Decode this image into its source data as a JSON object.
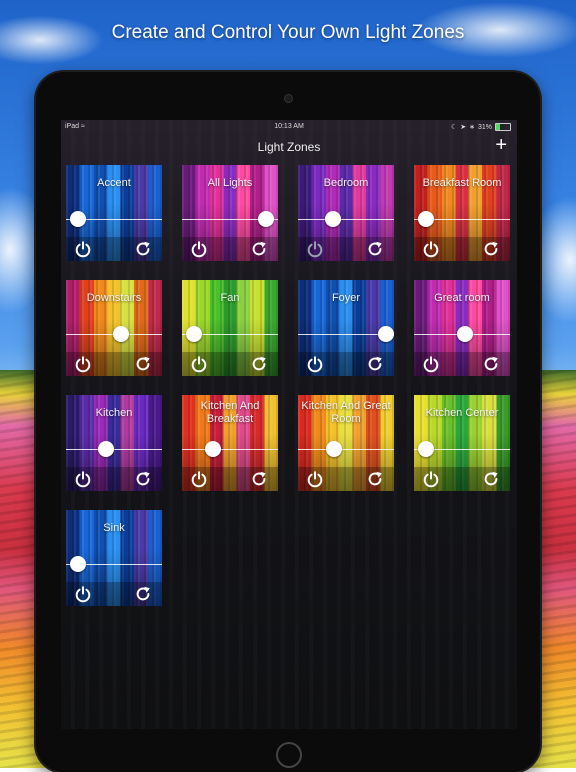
{
  "headline": "Create and Control Your Own Light Zones",
  "status_bar": {
    "carrier": "iPad",
    "time": "10:13 AM",
    "battery": "31%",
    "battery_level": 0.31
  },
  "nav": {
    "title": "Light Zones",
    "add_symbol": "+"
  },
  "icons": {
    "power": "power-icon",
    "refresh": "refresh-icon",
    "wifi": "wifi-icon",
    "add": "plus-icon"
  },
  "zones": [
    {
      "name": "Accent",
      "brightness": 0.12,
      "palette": "blue",
      "power_on": true
    },
    {
      "name": "All Lights",
      "brightness": 0.88,
      "palette": "magenta",
      "power_on": true
    },
    {
      "name": "Bedroom",
      "brightness": 0.36,
      "palette": "purple",
      "power_on": false
    },
    {
      "name": "Breakfast Room",
      "brightness": 0.12,
      "palette": "sunset",
      "power_on": true
    },
    {
      "name": "Downstairs",
      "brightness": 0.57,
      "palette": "rainbow",
      "power_on": true
    },
    {
      "name": "Fan",
      "brightness": 0.12,
      "palette": "limegreen",
      "power_on": true
    },
    {
      "name": "Foyer",
      "brightness": 0.92,
      "palette": "blue",
      "power_on": true
    },
    {
      "name": "Great room",
      "brightness": 0.53,
      "palette": "magenta",
      "power_on": true
    },
    {
      "name": "Kitchen",
      "brightness": 0.42,
      "palette": "violet",
      "power_on": true
    },
    {
      "name": "Kitchen And Breakfast",
      "brightness": 0.32,
      "palette": "warm",
      "power_on": true
    },
    {
      "name": "Kitchen And Great Room",
      "brightness": 0.37,
      "palette": "orange",
      "power_on": true
    },
    {
      "name": "Kitchen Center",
      "brightness": 0.12,
      "palette": "yellowgreen",
      "power_on": true
    },
    {
      "name": "Sink",
      "brightness": 0.12,
      "palette": "blue",
      "power_on": true
    }
  ]
}
